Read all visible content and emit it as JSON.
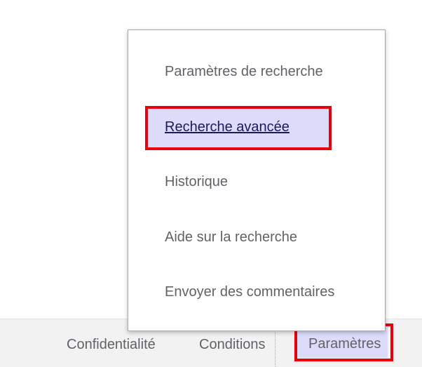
{
  "menu": {
    "items": [
      {
        "label": "Paramètres de recherche"
      },
      {
        "label": "Recherche avancée"
      },
      {
        "label": "Historique"
      },
      {
        "label": "Aide sur la recherche"
      },
      {
        "label": "Envoyer des commentaires"
      }
    ],
    "highlighted_item": "Recherche avancée"
  },
  "footer": {
    "links": [
      {
        "label": "Confidentialité"
      },
      {
        "label": "Conditions"
      },
      {
        "label": "Paramètres"
      }
    ]
  },
  "colors": {
    "highlight_background": "#dcdcfa",
    "annotation_box": "#e8000d",
    "link_text": "#5f6368",
    "footer_background": "#f2f2f2"
  }
}
